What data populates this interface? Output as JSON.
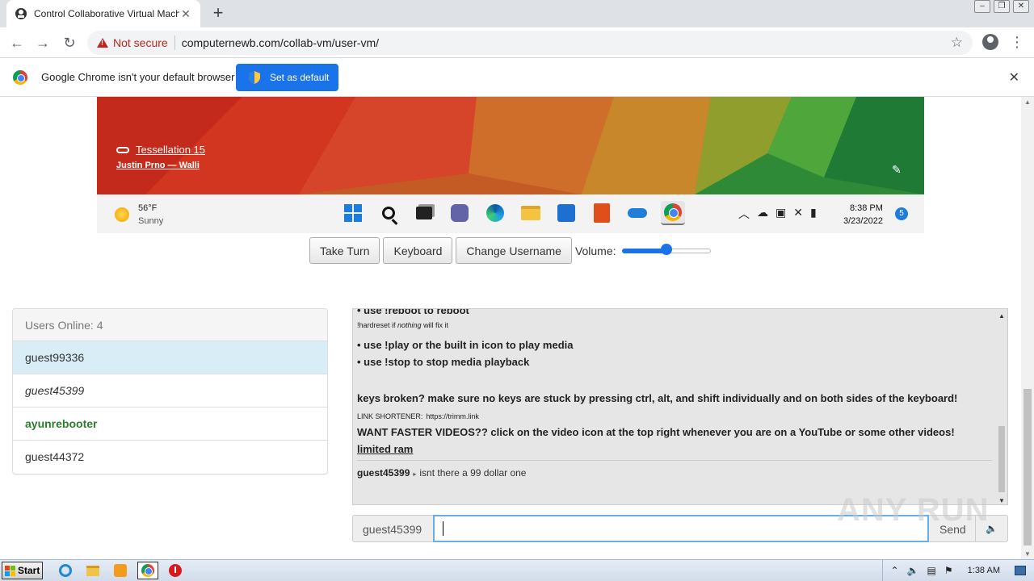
{
  "browser": {
    "tab_title": "Control Collaborative Virtual Machine",
    "security_label": "Not secure",
    "url": "computernewb.com/collab-vm/user-vm/"
  },
  "infobar": {
    "message": "Google Chrome isn't your default browser",
    "button_label": "Set as default"
  },
  "vm": {
    "wallpaper_name": "Tessellation 15",
    "wallpaper_author": "Justin Prno — Walli",
    "weather_temp": "56°F",
    "weather_condition": "Sunny",
    "clock_time": "8:38 PM",
    "clock_date": "3/23/2022",
    "notification_count": "5",
    "taskbar_icons": [
      "windows-start-icon",
      "search-icon",
      "task-view-icon",
      "teams-chat-icon",
      "edge-icon",
      "file-explorer-icon",
      "microsoft-store-icon",
      "office-icon",
      "onedrive-icon",
      "chrome-icon"
    ]
  },
  "controls": {
    "take_turn": "Take Turn",
    "keyboard": "Keyboard",
    "change_username": "Change Username",
    "volume_label": "Volume:",
    "volume_level": 0.5
  },
  "users": {
    "header": "Users Online: 4",
    "list": [
      {
        "name": "guest99336",
        "style": "me"
      },
      {
        "name": "guest45399",
        "style": "italic"
      },
      {
        "name": "ayunrebooter",
        "style": "admin"
      },
      {
        "name": "guest44372",
        "style": "normal"
      }
    ]
  },
  "chat": {
    "line_reboot": "• use !reboot to reboot",
    "line_hardreset_pre": "!hardreset if ",
    "line_hardreset_em": "nothing",
    "line_hardreset_post": " will fix it",
    "line_play": "• use !play or the built in icon to play media",
    "line_stop": "• use !stop to stop media playback",
    "line_keys": "keys broken? make sure no keys are stuck by pressing ctrl, alt, and shift individually and on both sides of the keyboard!",
    "line_shortener_label": "LINK SHORTENER:",
    "line_shortener_link": "https://trimm.link",
    "line_faster": "WANT FASTER VIDEOS?? click on the video icon at the top right whenever you are on a YouTube or some other videos!",
    "line_limited": "limited ram",
    "message_user": "guest45399",
    "message_text": "isnt there a 99 dollar one",
    "input_username": "guest45399",
    "input_value": "",
    "send_label": "Send"
  },
  "watermark": "ANY RUN",
  "os_taskbar": {
    "start_label": "Start",
    "time": "1:38 AM"
  }
}
